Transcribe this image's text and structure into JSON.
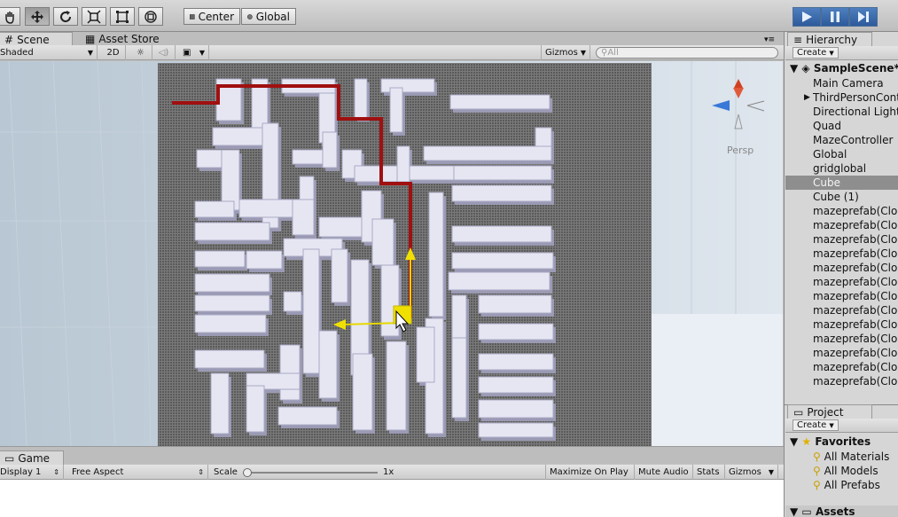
{
  "toolbar": {
    "tools": [
      {
        "name": "hand-tool",
        "label": "hand"
      },
      {
        "name": "move-tool",
        "label": "move"
      },
      {
        "name": "rotate-tool",
        "label": "rotate"
      },
      {
        "name": "scale-tool",
        "label": "scale"
      },
      {
        "name": "rect-tool",
        "label": "rect"
      },
      {
        "name": "transform-tool",
        "label": "transform"
      }
    ],
    "pivot_mode": "Center",
    "pivot_rotation": "Global"
  },
  "scene_panel": {
    "tab_label": "Scene",
    "asset_store_tab": "Asset Store",
    "shading_mode": "Shaded",
    "mode_2d": "2D",
    "gizmos_label": "Gizmos",
    "search_placeholder": "All",
    "camera_label": "Persp"
  },
  "game_panel": {
    "tab_label": "Game",
    "display": "Display 1",
    "aspect": "Free Aspect",
    "scale_label": "Scale",
    "scale_value": "1x",
    "maximize_label": "Maximize On Play",
    "mute_label": "Mute Audio",
    "stats_label": "Stats",
    "gizmos_label": "Gizmos"
  },
  "hierarchy": {
    "tab_label": "Hierarchy",
    "create_label": "Create",
    "scene_name": "SampleScene*",
    "items": [
      {
        "label": "Main Camera",
        "selected": false
      },
      {
        "label": "ThirdPersonCont",
        "selected": false
      },
      {
        "label": "Directional Light",
        "selected": false
      },
      {
        "label": "Quad",
        "selected": false
      },
      {
        "label": "MazeController",
        "selected": false
      },
      {
        "label": "Global",
        "selected": false
      },
      {
        "label": "gridglobal",
        "selected": false
      },
      {
        "label": "Cube",
        "selected": true
      },
      {
        "label": "Cube (1)",
        "selected": false
      },
      {
        "label": "mazeprefab(Clon",
        "selected": false
      },
      {
        "label": "mazeprefab(Clon",
        "selected": false
      },
      {
        "label": "mazeprefab(Clon",
        "selected": false
      },
      {
        "label": "mazeprefab(Clon",
        "selected": false
      },
      {
        "label": "mazeprefab(Clon",
        "selected": false
      },
      {
        "label": "mazeprefab(Clon",
        "selected": false
      },
      {
        "label": "mazeprefab(Clon",
        "selected": false
      },
      {
        "label": "mazeprefab(Clon",
        "selected": false
      },
      {
        "label": "mazeprefab(Clon",
        "selected": false
      },
      {
        "label": "mazeprefab(Clon",
        "selected": false
      },
      {
        "label": "mazeprefab(Clon",
        "selected": false
      },
      {
        "label": "mazeprefab(Clon",
        "selected": false
      },
      {
        "label": "mazeprefab(Clon",
        "selected": false
      }
    ]
  },
  "project": {
    "tab_label": "Project",
    "create_label": "Create",
    "favorites_label": "Favorites",
    "favorites": [
      "All Materials",
      "All Models",
      "All Prefabs"
    ],
    "assets_label": "Assets"
  },
  "colors": {
    "accent_blue": "#3a6fb8",
    "path_red": "#a01010",
    "gizmo_yellow": "#f0e000",
    "wall_face": "#e6e6f3"
  }
}
